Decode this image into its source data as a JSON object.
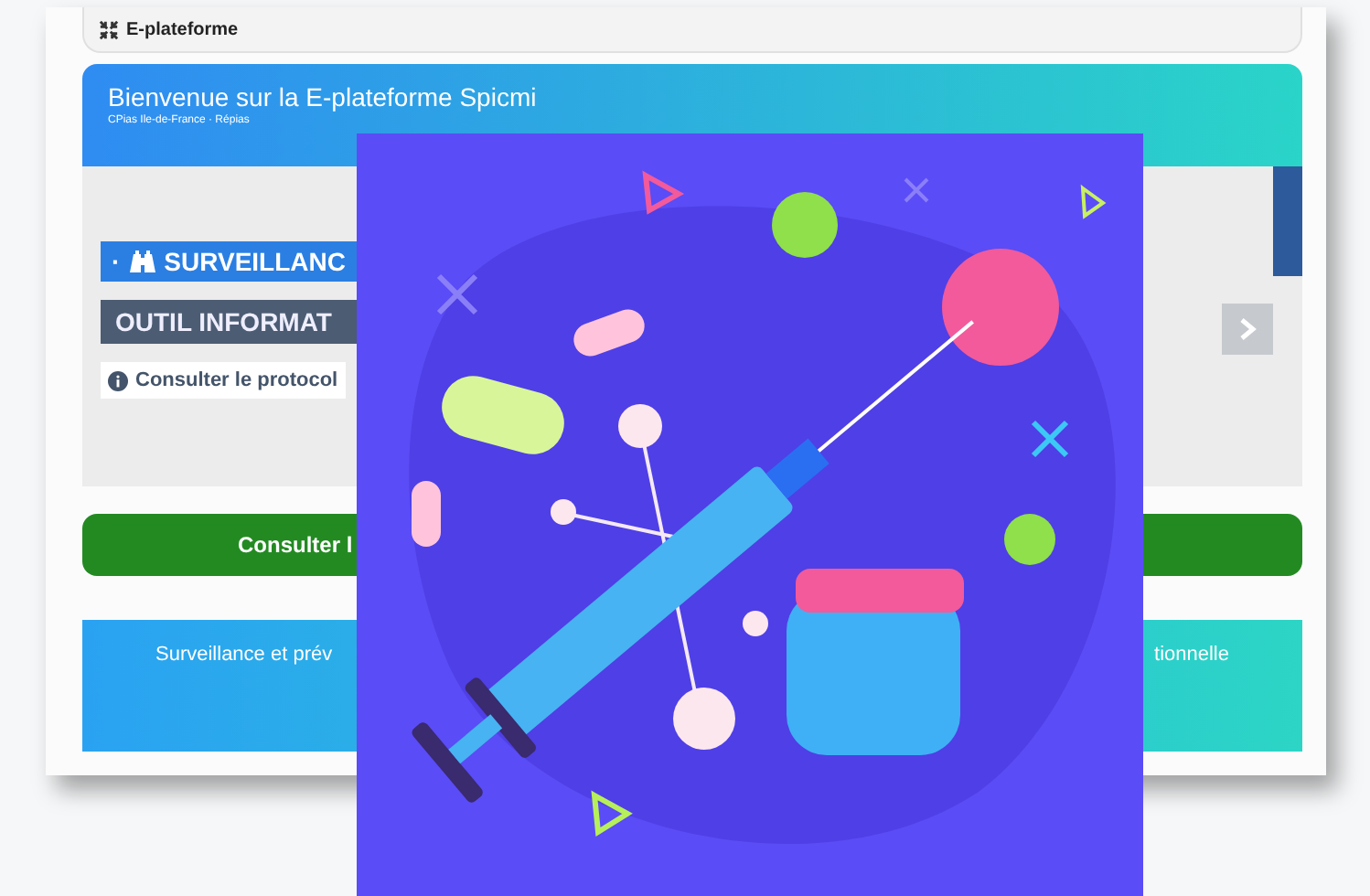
{
  "top_bar": {
    "title": "E-plateforme"
  },
  "header": {
    "title": "Bienvenue sur la E-plateforme Spicmi",
    "subtitle": "CPias Ile-de-France · Répias"
  },
  "slide": {
    "bullet": "·",
    "heading": "SURVEILLANC",
    "tool_label": "OUTIL INFORMAT",
    "protocol_link": "Consulter le protocol"
  },
  "primary_button": "Consulter l",
  "banner": {
    "text_left": "Surveillance et prév",
    "text_right": "tionnelle"
  }
}
